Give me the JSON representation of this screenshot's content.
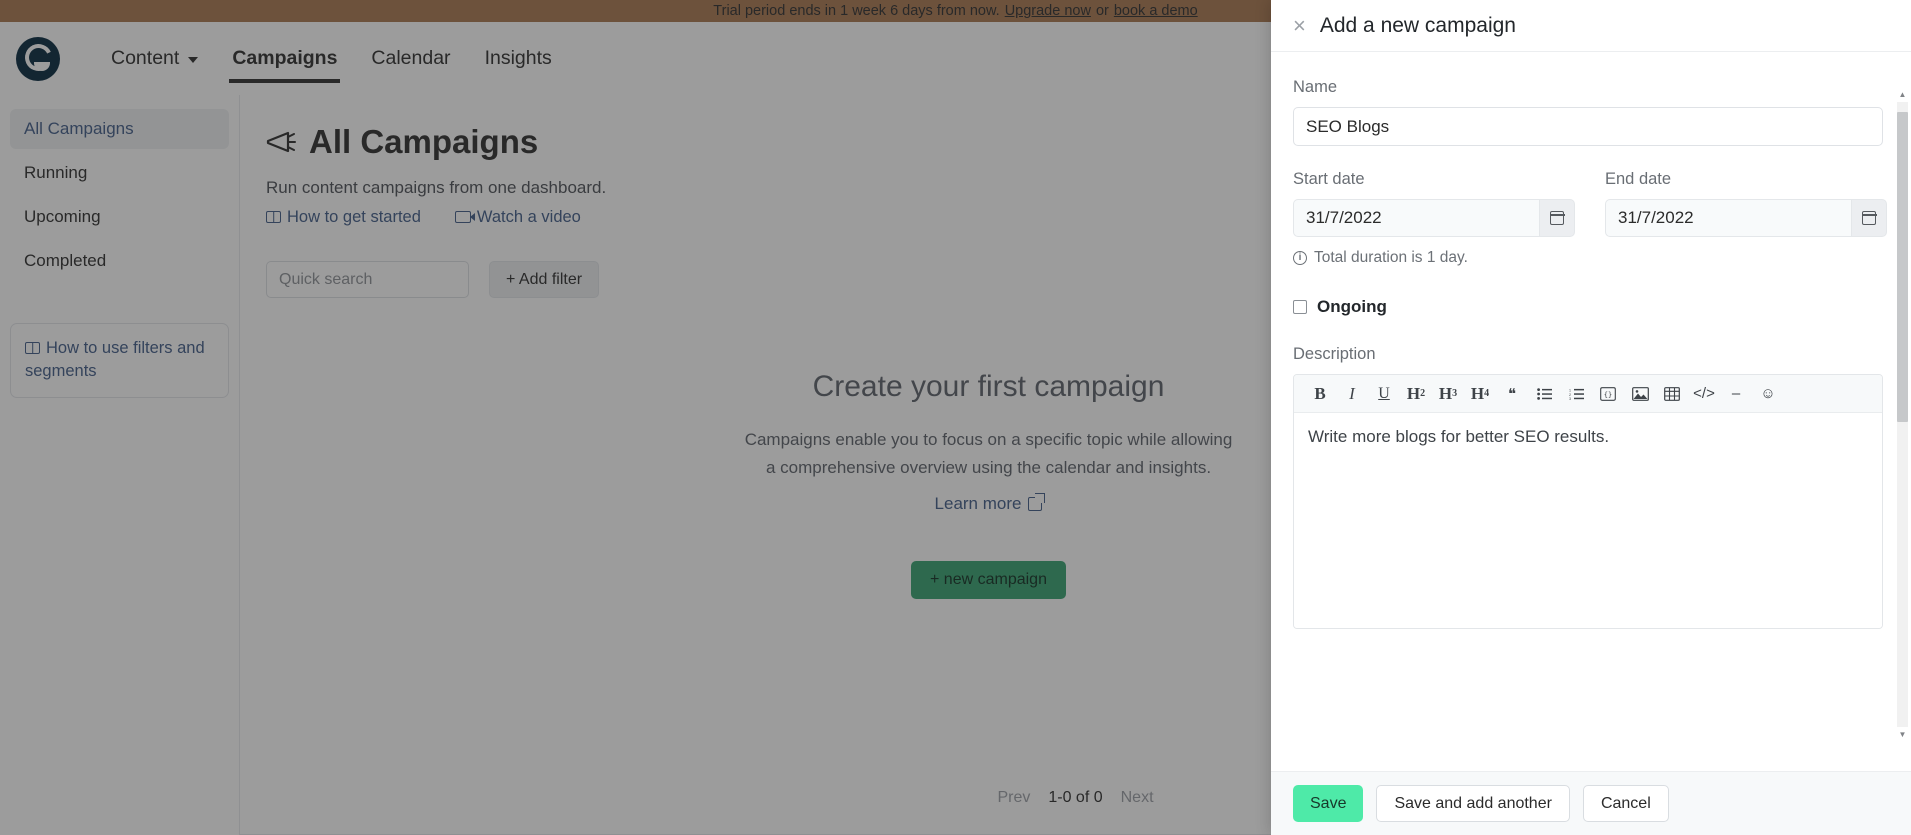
{
  "banner": {
    "text_before": "Trial period ends in 1 week 6 days from now.",
    "upgrade_link": "Upgrade now",
    "conjunction": "or",
    "demo_link": "book a demo"
  },
  "topnav": {
    "logo_name": "mailchimp-logo",
    "items": [
      {
        "label": "Content",
        "has_caret": true
      },
      {
        "label": "Campaigns",
        "has_caret": false
      },
      {
        "label": "Calendar",
        "has_caret": false
      },
      {
        "label": "Insights",
        "has_caret": false
      }
    ],
    "active": "Campaigns"
  },
  "sidebar": {
    "items": [
      {
        "label": "All Campaigns",
        "selected": true
      },
      {
        "label": "Running",
        "selected": false
      },
      {
        "label": "Upcoming",
        "selected": false
      },
      {
        "label": "Completed",
        "selected": false
      }
    ],
    "help_card": "How to use filters and segments"
  },
  "main": {
    "title": "All Campaigns",
    "subtitle": "Run content campaigns from one dashboard.",
    "link_started": "How to get started",
    "link_video": "Watch a video",
    "search_placeholder": "Quick search",
    "search_value": "",
    "add_filter": "+ Add filter",
    "empty_title": "Create your first campaign",
    "empty_desc_line1": "Campaigns enable you to focus on a specific topic while allowing",
    "empty_desc_line2": "a comprehensive overview using the calendar and insights.",
    "empty_link": "Learn more",
    "new_campaign": "+ new campaign",
    "pagination": {
      "prev": "Prev",
      "count": "1-0 of 0",
      "next": "Next"
    }
  },
  "drawer": {
    "title": "Add a new campaign",
    "close_label": "×",
    "name_label": "Name",
    "name_value": "SEO Blogs",
    "name_placeholder": "",
    "start_label": "Start date",
    "start_value": "31/7/2022",
    "end_label": "End date",
    "end_value": "31/7/2022",
    "duration_note": "Total duration is 1 day.",
    "info_glyph": "i",
    "ongoing_label": "Ongoing",
    "ongoing_checked": false,
    "description_label": "Description",
    "description_value": "Write more blogs for better SEO results.",
    "toolbar": [
      {
        "name": "bold-icon",
        "glyph": "B",
        "style": "serif"
      },
      {
        "name": "italic-icon",
        "glyph": "I",
        "style": "ital"
      },
      {
        "name": "underline-icon",
        "glyph": "U",
        "style": "und"
      },
      {
        "name": "heading-2-icon",
        "glyph": "H",
        "sub": "2",
        "style": "hx"
      },
      {
        "name": "heading-3-icon",
        "glyph": "H",
        "sub": "3",
        "style": "hx"
      },
      {
        "name": "heading-4-icon",
        "glyph": "H",
        "sub": "4",
        "style": "hx"
      },
      {
        "name": "blockquote-icon",
        "glyph": "❝",
        "style": "plain"
      },
      {
        "name": "bullet-list-icon",
        "glyph": "☰",
        "style": "plain"
      },
      {
        "name": "numbered-list-icon",
        "glyph": "☷",
        "style": "plain"
      },
      {
        "name": "code-block-icon",
        "glyph": "{}",
        "style": "plain"
      },
      {
        "name": "image-icon",
        "glyph": "⛰",
        "style": "plain"
      },
      {
        "name": "table-icon",
        "glyph": "▦",
        "style": "plain"
      },
      {
        "name": "html-code-icon",
        "glyph": "</>",
        "style": "plain"
      },
      {
        "name": "horizontal-rule-icon",
        "glyph": "–",
        "style": "plain"
      },
      {
        "name": "emoji-icon",
        "glyph": "☺",
        "style": "plain"
      }
    ],
    "footer": {
      "save": "Save",
      "save_add_another": "Save and add another",
      "cancel": "Cancel"
    }
  },
  "colors": {
    "banner_bg": "#a8764f",
    "primary_green": "#4eeaa8",
    "new_campaign_green": "#35a270",
    "link_blue": "#3f5b88"
  }
}
